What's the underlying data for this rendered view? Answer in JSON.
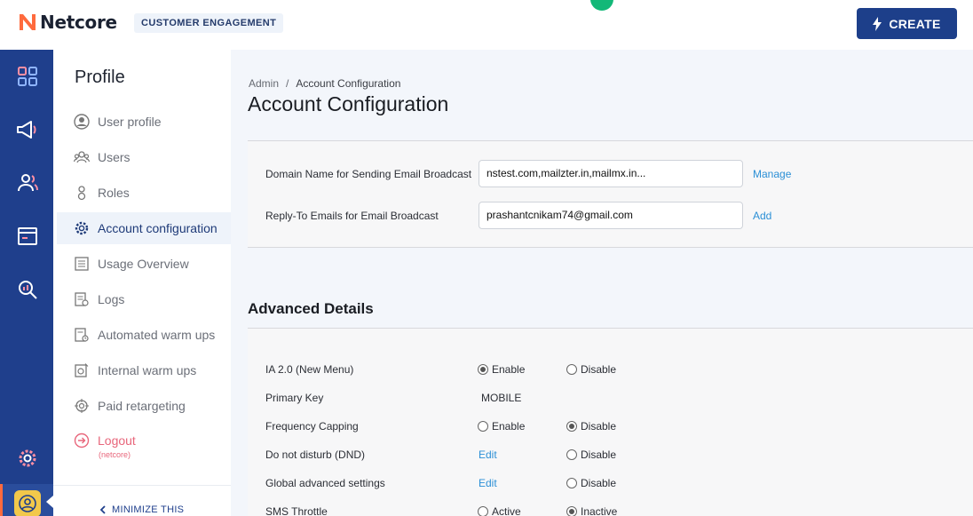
{
  "brand": {
    "name": "Netcore",
    "product": "CUSTOMER ENGAGEMENT",
    "accent": "#ff6a3d",
    "primary": "#1d3f8a"
  },
  "header": {
    "create_label": "CREATE"
  },
  "rail": {
    "icons": [
      "dashboard-icon",
      "megaphone-icon",
      "audience-icon",
      "template-icon",
      "analytics-icon",
      "settings-icon",
      "profile-avatar-icon"
    ]
  },
  "subnav": {
    "title": "Profile",
    "items": [
      {
        "label": "User profile",
        "icon": "user-circle-icon"
      },
      {
        "label": "Users",
        "icon": "users-icon"
      },
      {
        "label": "Roles",
        "icon": "roles-icon"
      },
      {
        "label": "Account configuration",
        "icon": "gear-icon",
        "active": true
      },
      {
        "label": "Usage Overview",
        "icon": "list-icon"
      },
      {
        "label": "Logs",
        "icon": "logs-icon"
      },
      {
        "label": "Automated warm ups",
        "icon": "automated-icon"
      },
      {
        "label": "Internal warm ups",
        "icon": "internal-icon"
      },
      {
        "label": "Paid retargeting",
        "icon": "target-icon"
      }
    ],
    "logout_label": "Logout",
    "logout_sub": "(netcore)",
    "minimize_label": "MINIMIZE THIS"
  },
  "breadcrumb": {
    "root": "Admin",
    "separator": "/",
    "current": "Account Configuration"
  },
  "page_title": "Account Configuration",
  "email_config": {
    "domain_label": "Domain Name for Sending Email Broadcast",
    "domain_value": "nstest.com,mailzter.in,mailmx.in...",
    "domain_link": "Manage",
    "reply_label": "Reply-To Emails for Email Broadcast",
    "reply_value": "prashantcnikam74@gmail.com",
    "reply_link": "Add"
  },
  "advanced": {
    "title": "Advanced Details",
    "ia": {
      "label": "IA 2.0 (New Menu)",
      "opt1": "Enable",
      "opt2": "Disable",
      "selected": "Enable"
    },
    "primary_key": {
      "label": "Primary Key",
      "value": "MOBILE"
    },
    "frequency": {
      "label": "Frequency Capping",
      "opt1": "Enable",
      "opt2": "Disable",
      "selected": "Disable"
    },
    "dnd": {
      "label": "Do not disturb (DND)",
      "edit": "Edit",
      "opt2": "Disable"
    },
    "global": {
      "label": "Global advanced settings",
      "edit": "Edit",
      "opt2": "Disable"
    },
    "sms": {
      "label": "SMS Throttle",
      "opt1": "Active",
      "opt2": "Inactive",
      "selected": "Inactive"
    }
  }
}
